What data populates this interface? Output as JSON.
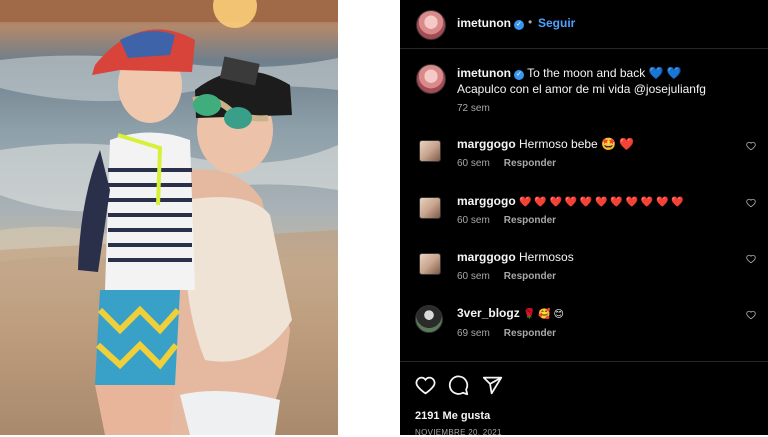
{
  "post": {
    "author": "imetunon",
    "follow_label": "Seguir",
    "separator": "•",
    "caption_title": "To the moon and back",
    "caption_emoji": "💙 💙",
    "caption_line2": "Acapulco con el amor de mi vida @josejulianfg",
    "caption_age": "72 sem"
  },
  "comments": [
    {
      "user": "marggogo",
      "text": "Hermoso bebe",
      "emoji": "🤩 ❤️",
      "age": "60 sem",
      "reply": "Responder"
    },
    {
      "user": "marggogo",
      "text": "",
      "emoji": "❤️ ❤️ ❤️ ❤️ ❤️ ❤️ ❤️ ❤️ ❤️ ❤️ ❤️",
      "age": "60 sem",
      "reply": "Responder"
    },
    {
      "user": "marggogo",
      "text": "Hermosos",
      "emoji": "",
      "age": "60 sem",
      "reply": "Responder"
    },
    {
      "user": "3ver_blogz",
      "text": "",
      "emoji": "🌹 🥰 😊",
      "age": "69 sem",
      "reply": "Responder"
    }
  ],
  "footer": {
    "likes": "2191 Me gusta",
    "date": "NOVIEMBRE 20, 2021"
  },
  "icons": [
    "heart-outline-icon",
    "comment-icon",
    "share-icon",
    "verified-badge-icon"
  ],
  "colors": {
    "accent": "#4da3ff",
    "verified": "#3897f0",
    "heart": "#ed4956",
    "panel": "#000000"
  }
}
